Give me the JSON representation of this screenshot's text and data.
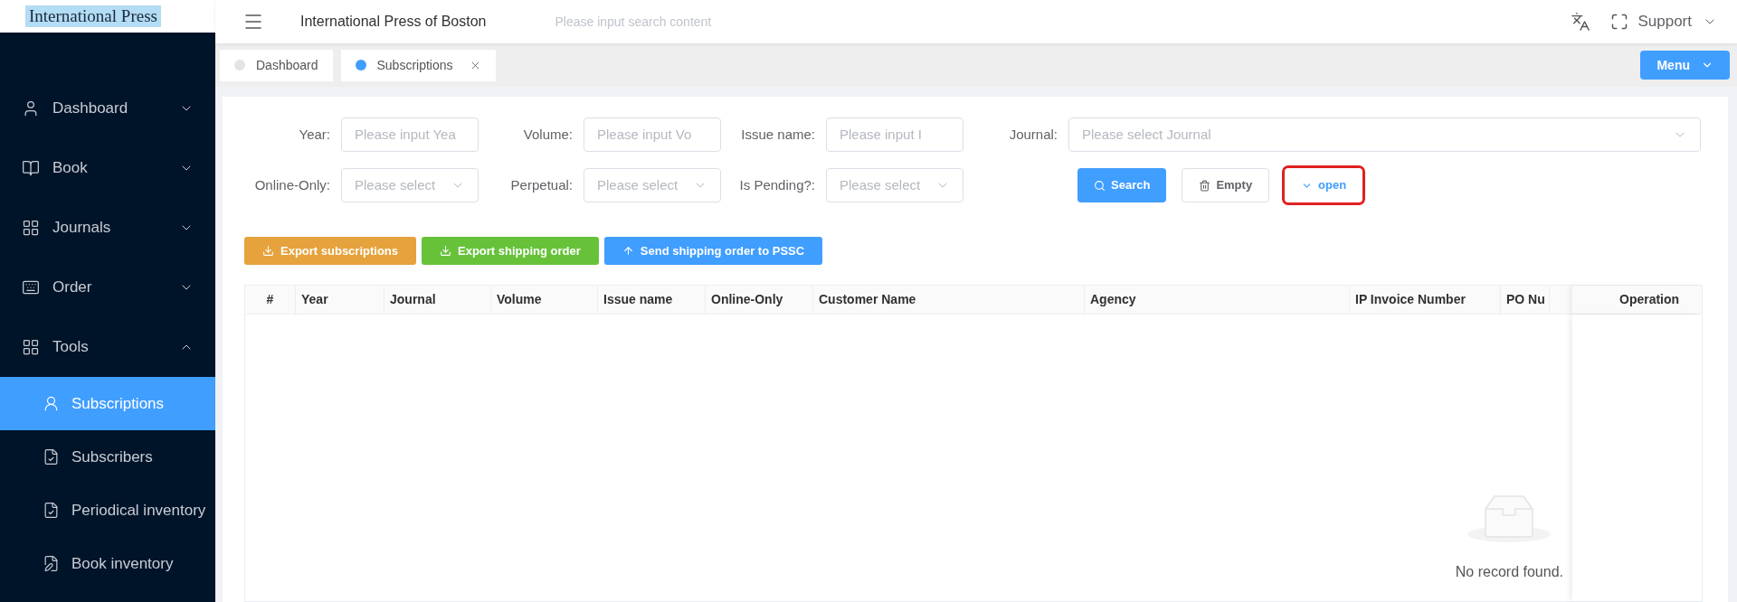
{
  "logo": {
    "text": "International Press"
  },
  "header": {
    "title": "International Press of Boston",
    "search_placeholder": "Please input search content",
    "user": "Support"
  },
  "tabs": [
    {
      "label": "Dashboard",
      "selected": false,
      "closable": false
    },
    {
      "label": "Subscriptions",
      "selected": true,
      "closable": true
    }
  ],
  "menu_button": "Menu",
  "sidebar": {
    "items": [
      {
        "label": "Dashboard",
        "expanded": false
      },
      {
        "label": "Book",
        "expanded": false
      },
      {
        "label": "Journals",
        "expanded": false
      },
      {
        "label": "Order",
        "expanded": false
      },
      {
        "label": "Tools",
        "expanded": true,
        "children": [
          {
            "label": "Subscriptions",
            "selected": true
          },
          {
            "label": "Subscribers",
            "selected": false
          },
          {
            "label": "Periodical inventory",
            "selected": false
          },
          {
            "label": "Book inventory",
            "selected": false
          }
        ]
      }
    ]
  },
  "filters": {
    "rows": [
      [
        {
          "label": "Year:",
          "placeholder": "Please input Yea",
          "kind": "input"
        },
        {
          "label": "Volume:",
          "placeholder": "Please input Vo",
          "kind": "input"
        },
        {
          "label": "Issue name:",
          "placeholder": "Please input I",
          "kind": "input"
        },
        {
          "label": "Journal:",
          "placeholder": "Please select Journal",
          "kind": "select"
        }
      ],
      [
        {
          "label": "Online-Only:",
          "placeholder": "Please select",
          "kind": "select"
        },
        {
          "label": "Perpetual:",
          "placeholder": "Please select",
          "kind": "select"
        },
        {
          "label": "Is Pending?:",
          "placeholder": "Please select",
          "kind": "select"
        }
      ]
    ],
    "actions": [
      {
        "label": "Search",
        "kind": "search",
        "highlighted": false
      },
      {
        "label": "Empty",
        "kind": "empty",
        "highlighted": false
      },
      {
        "label": "open",
        "kind": "toggle",
        "highlighted": true
      }
    ]
  },
  "export_buttons": [
    {
      "label": "Export subscriptions",
      "kind": "download",
      "color": "#e6a23c"
    },
    {
      "label": "Export shipping order",
      "kind": "download",
      "color": "#67c23a"
    },
    {
      "label": "Send shipping order to PSSC",
      "kind": "upload",
      "color": "#409eff"
    }
  ],
  "table": {
    "columns": [
      "#",
      "Year",
      "Journal",
      "Volume",
      "Issue name",
      "Online-Only",
      "Customer Name",
      "Agency",
      "IP Invoice Number",
      "PO Nu"
    ],
    "fixed_column": "Operation",
    "empty_text": "No record found."
  }
}
